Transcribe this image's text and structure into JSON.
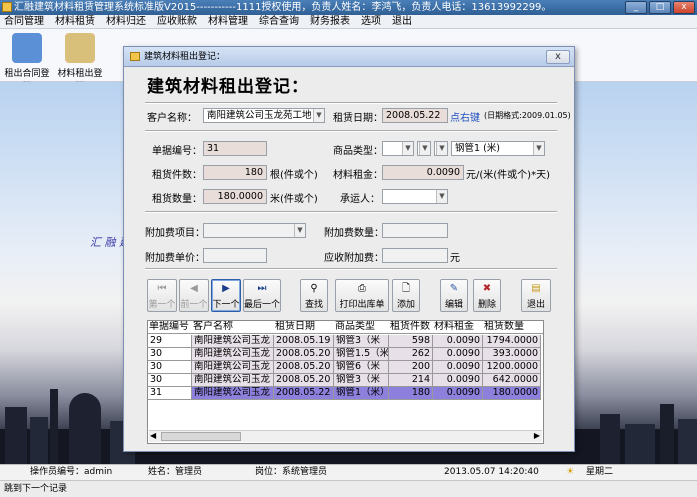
{
  "app": {
    "title": "汇融建筑材料租赁管理系统标准版V2015-----------1111授权使用，负责人姓名：李鸿飞，负责人电话：13613992299。",
    "menu": [
      "合同管理",
      "材料租赁",
      "材料归还",
      "应收账款",
      "材料管理",
      "综合查询",
      "财务报表",
      "选项",
      "退出"
    ],
    "toolbar": [
      {
        "label": "租出合同登记",
        "icon": "contract-icon",
        "color": "#5b8fd6"
      },
      {
        "label": "材料租出登记",
        "icon": "notepad-icon",
        "color": "#d9c07a"
      }
    ],
    "desktop_text": "汇 融 建",
    "window_buttons": {
      "min": "_",
      "max": "□",
      "close": "x"
    }
  },
  "dialog": {
    "title": "建筑材料租出登记：",
    "close": "x",
    "heading": "建筑材料租出登记：",
    "customer_label": "客户名称：",
    "customer_value": "南阳建筑公司玉龙苑工地",
    "date_label": "租赁日期：",
    "date_value": "2008.05.22",
    "date_link": "点右键",
    "date_format": "(日期格式:2009.01.05)",
    "no_label": "单据编号：",
    "no_value": "31",
    "type_label": "商品类型：",
    "type_value": "钢管1 (米)",
    "qty_label": "租货件数：",
    "qty_value": "180",
    "qty_unit": "根(件或个)",
    "rent_label": "材料租金：",
    "rent_value": "0.0090",
    "rent_unit": "元/(米(件或个)*天)",
    "amount_label": "租货数量：",
    "amount_value": "180.0000",
    "amount_unit": "米(件或个)",
    "carrier_label": "承运人：",
    "extra_item_label": "附加费项目：",
    "extra_qty_label": "附加费数量：",
    "extra_price_label": "附加费单价：",
    "extra_recv_label": "应收附加费：",
    "extra_unit": "元",
    "buttons": {
      "first": "第一个",
      "prev": "前一个",
      "next": "下一个",
      "last": "最后一个",
      "search": "查找",
      "print": "打印出库单",
      "add": "添加",
      "edit": "编辑",
      "delete": "删除",
      "exit": "退出"
    },
    "grid": {
      "headers": [
        "单据编号",
        "客户名称",
        "租赁日期",
        "商品类型",
        "租货件数",
        "材料租金",
        "租赁数量"
      ],
      "rows": [
        {
          "no": "29",
          "customer": "南阳建筑公司玉龙",
          "date": "2008.05.19",
          "type": "钢管3（米",
          "qty": "598",
          "rent": "0.0090",
          "amount": "1794.0000",
          "selected": false
        },
        {
          "no": "30",
          "customer": "南阳建筑公司玉龙",
          "date": "2008.05.20",
          "type": "钢管1.5（米",
          "qty": "262",
          "rent": "0.0090",
          "amount": "393.0000",
          "selected": false
        },
        {
          "no": "30",
          "customer": "南阳建筑公司玉龙",
          "date": "2008.05.20",
          "type": "钢管6（米",
          "qty": "200",
          "rent": "0.0090",
          "amount": "1200.0000",
          "selected": false
        },
        {
          "no": "30",
          "customer": "南阳建筑公司玉龙",
          "date": "2008.05.20",
          "type": "钢管3（米",
          "qty": "214",
          "rent": "0.0090",
          "amount": "642.0000",
          "selected": false
        },
        {
          "no": "31",
          "customer": "南阳建筑公司玉龙",
          "date": "2008.05.22",
          "type": "钢管1（米）",
          "qty": "180",
          "rent": "0.0090",
          "amount": "180.0000",
          "selected": true
        }
      ]
    }
  },
  "status": {
    "operator": "操作员编号：admin",
    "name": "姓名：管理员",
    "post": "岗位：系统管理员",
    "datetime": "2013.05.07  14:20:40",
    "weekday": "星期二"
  },
  "bottom_status": "跳到下一个记录"
}
